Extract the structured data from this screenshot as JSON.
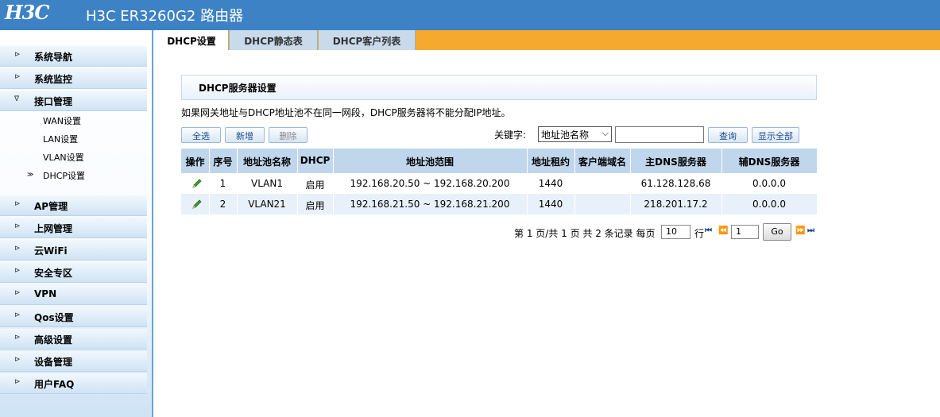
{
  "header": {
    "logo": "H3C",
    "title": "H3C ER3260G2 路由器"
  },
  "sidebar": {
    "items": [
      {
        "label": "系统导航",
        "arrow": "⊳"
      },
      {
        "label": "系统监控",
        "arrow": "⊳"
      },
      {
        "label": "接口管理",
        "arrow": "∇"
      },
      {
        "label": "AP管理",
        "arrow": "⊳"
      },
      {
        "label": "上网管理",
        "arrow": "⊳"
      },
      {
        "label": "云WiFi",
        "arrow": "⊳"
      },
      {
        "label": "安全专区",
        "arrow": "⊳"
      },
      {
        "label": "VPN",
        "arrow": "⊳"
      },
      {
        "label": "Qos设置",
        "arrow": "⊳"
      },
      {
        "label": "高级设置",
        "arrow": "⊳"
      },
      {
        "label": "设备管理",
        "arrow": "⊳"
      },
      {
        "label": "用户FAQ",
        "arrow": "⊳"
      }
    ],
    "subitems": [
      {
        "label": "WAN设置"
      },
      {
        "label": "LAN设置"
      },
      {
        "label": "VLAN设置"
      },
      {
        "label": "DHCP设置",
        "marker": "≫"
      }
    ]
  },
  "tabs": [
    {
      "label": "DHCP设置"
    },
    {
      "label": "DHCP静态表"
    },
    {
      "label": "DHCP客户列表"
    }
  ],
  "section": {
    "title": "DHCP服务器设置",
    "notice": "如果网关地址与DHCP地址池不在同一网段，DHCP服务器将不能分配IP地址。"
  },
  "toolbar": {
    "select_all": "全选",
    "add": "新增",
    "delete": "删除",
    "keyword_label": "关键字:",
    "keyword_select": "地址池名称",
    "search": "查询",
    "show_all": "显示全部"
  },
  "table": {
    "headers": [
      "操作",
      "序号",
      "地址池名称",
      "DHCP",
      "地址池范围",
      "地址租约",
      "客户端域名",
      "主DNS服务器",
      "辅DNS服务器"
    ],
    "rows": [
      {
        "no": "1",
        "name": "VLAN1",
        "dhcp": "启用",
        "range": "192.168.20.50 ~ 192.168.20.200",
        "lease": "1440",
        "domain": "",
        "dns1": "61.128.128.68",
        "dns2": "0.0.0.0"
      },
      {
        "no": "2",
        "name": "VLAN21",
        "dhcp": "启用",
        "range": "192.168.21.50 ~ 192.168.21.200",
        "lease": "1440",
        "domain": "",
        "dns1": "218.201.17.2",
        "dns2": "0.0.0.0"
      }
    ]
  },
  "pager": {
    "summary": "第 1 页/共 1 页 共 2 条记录 每页",
    "per_page": "10",
    "rows_unit": "行",
    "page": "1",
    "go": "Go"
  },
  "colors": {
    "header_bg": "#3d82c4",
    "tabbar_bg": "#f5a92e",
    "table_head_bg": "#bfd6ec"
  }
}
